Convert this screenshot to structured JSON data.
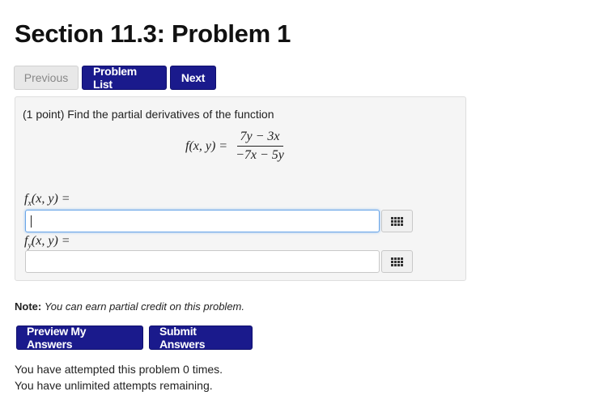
{
  "page": {
    "title": "Section 11.3: Problem 1"
  },
  "nav": {
    "previous": "Previous",
    "problem_list": "Problem List",
    "next": "Next"
  },
  "problem": {
    "points_text": "(1 point) Find the partial derivatives of the function",
    "function_lhs": "f(x, y) =",
    "numerator": "7y − 3x",
    "denominator": "−7x − 5y",
    "parts": [
      {
        "label_f": "f",
        "label_sub": "x",
        "label_rest": "(x, y) =",
        "value": ""
      },
      {
        "label_f": "f",
        "label_sub": "y",
        "label_rest": "(x, y) =",
        "value": ""
      }
    ]
  },
  "note": {
    "label": "Note:",
    "text": "You can earn partial credit on this problem."
  },
  "actions": {
    "preview": "Preview My Answers",
    "submit": "Submit Answers"
  },
  "status": {
    "attempted": "You have attempted this problem 0 times.",
    "remaining": "You have unlimited attempts remaining."
  },
  "icons": {
    "palette": "equation-palette-grid-icon",
    "caret": "text-cursor"
  },
  "colors": {
    "primary_button": "#1a1a8c",
    "focus_border": "#6aa6e8",
    "panel_bg": "#f5f5f5"
  }
}
